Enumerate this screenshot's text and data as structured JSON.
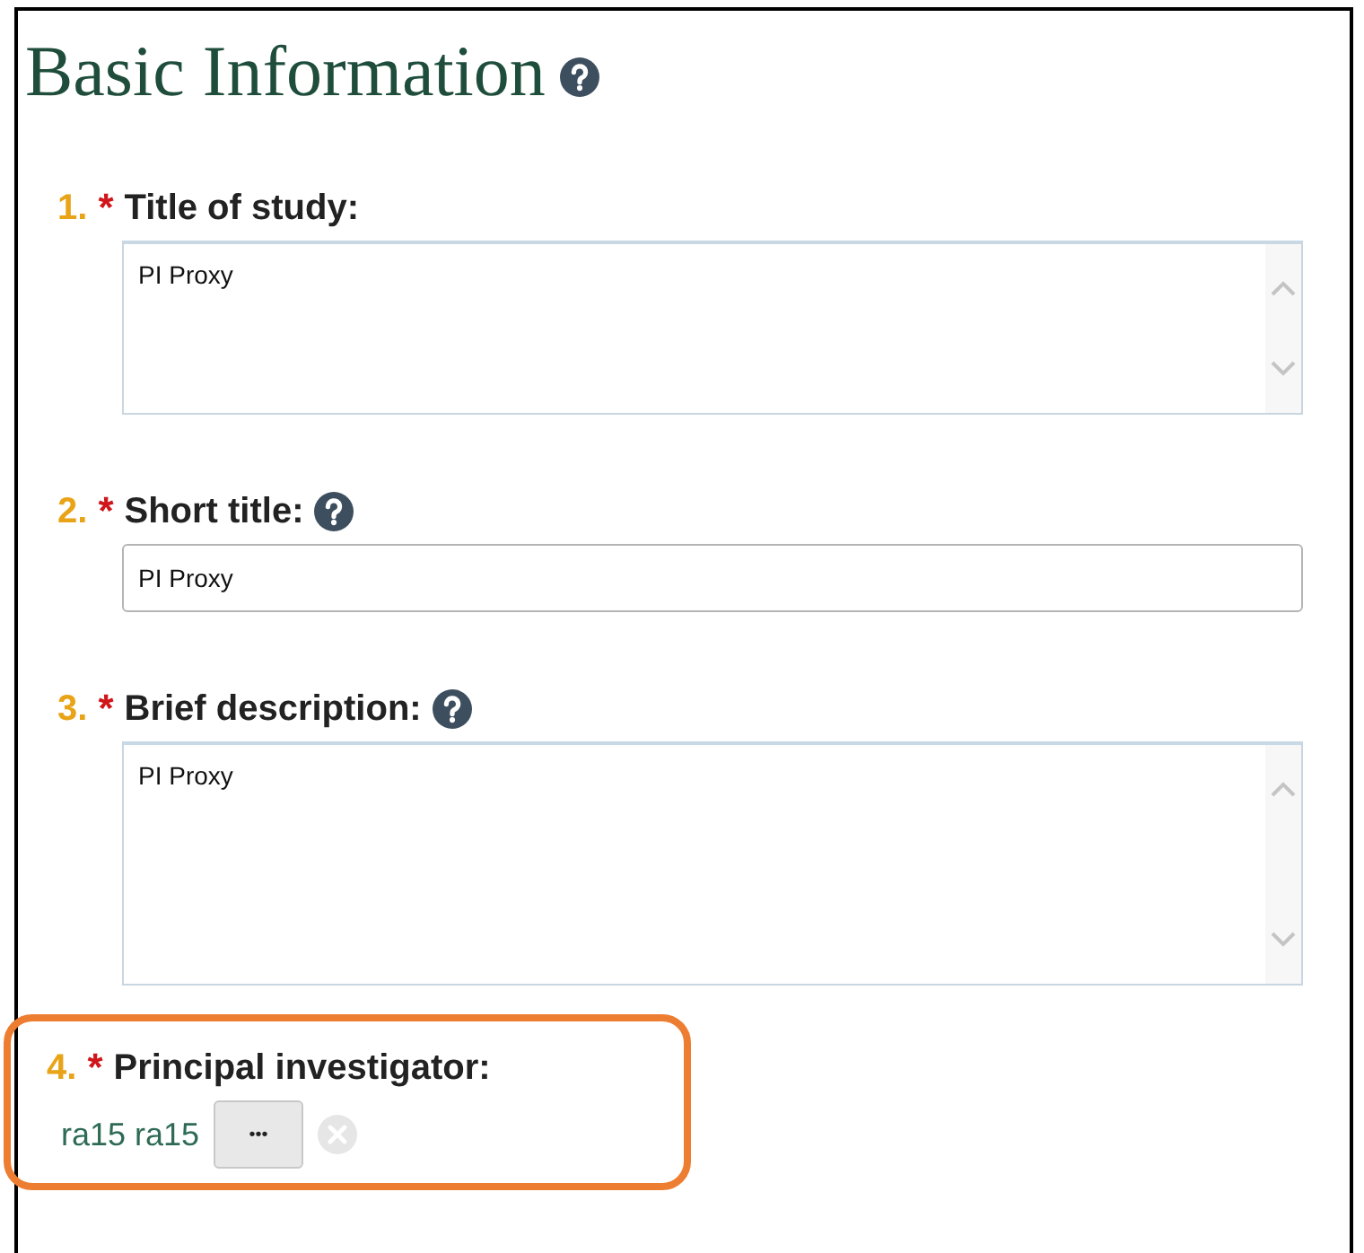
{
  "heading": {
    "title": "Basic Information",
    "help": true
  },
  "questions": [
    {
      "number": "1.",
      "required_mark": "*",
      "label": "Title of study:",
      "help": false,
      "kind": "textarea",
      "value": "PI Proxy",
      "highlighted": false
    },
    {
      "number": "2.",
      "required_mark": "*",
      "label": "Short title:",
      "help": true,
      "kind": "input",
      "value": "PI Proxy",
      "highlighted": false
    },
    {
      "number": "3.",
      "required_mark": "*",
      "label": "Brief description:",
      "help": true,
      "kind": "textarea",
      "value": "PI Proxy",
      "highlighted": false
    },
    {
      "number": "4.",
      "required_mark": "*",
      "label": "Principal investigator:",
      "help": false,
      "kind": "person",
      "value": "ra15 ra15",
      "button": "•••",
      "highlighted": true
    }
  ]
}
